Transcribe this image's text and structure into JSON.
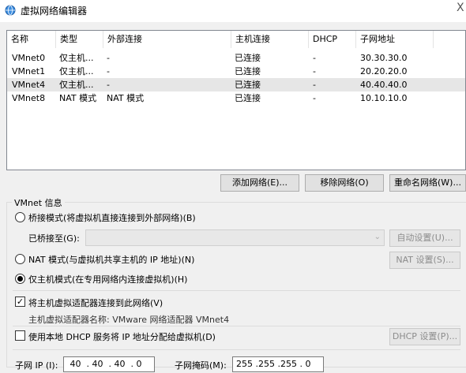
{
  "window": {
    "title": "虚拟网络编辑器",
    "icon": "network-globe-icon",
    "close": "X"
  },
  "table": {
    "headers": [
      "名称",
      "类型",
      "外部连接",
      "主机连接",
      "DHCP",
      "子网地址"
    ],
    "rows": [
      {
        "name": "VMnet0",
        "type": "仅主机...",
        "external": "-",
        "host": "已连接",
        "dhcp": "-",
        "subnet": "30.30.30.0",
        "selected": false
      },
      {
        "name": "VMnet1",
        "type": "仅主机...",
        "external": "-",
        "host": "已连接",
        "dhcp": "-",
        "subnet": "20.20.20.0",
        "selected": false
      },
      {
        "name": "VMnet4",
        "type": "仅主机...",
        "external": "-",
        "host": "已连接",
        "dhcp": "-",
        "subnet": "40.40.40.0",
        "selected": true
      },
      {
        "name": "VMnet8",
        "type": "NAT 模式",
        "external": "NAT 模式",
        "host": "已连接",
        "dhcp": "-",
        "subnet": "10.10.10.0",
        "selected": false
      }
    ]
  },
  "buttons": {
    "add": "添加网络(E)...",
    "remove": "移除网络(O)",
    "rename": "重命名网络(W)..."
  },
  "vmnet_info": {
    "title": "VMnet 信息",
    "bridged_label": "桥接模式(将虚拟机直接连接到外部网络)(B)",
    "bridged_to_label": "已桥接至(G):",
    "bridged_to_value": "",
    "auto_settings": "自动设置(U)...",
    "nat_label": "NAT 模式(与虚拟机共享主机的 IP 地址)(N)",
    "nat_settings": "NAT 设置(S)...",
    "hostonly_label": "仅主机模式(在专用网络内连接虚拟机)(H)",
    "mode_selected": "hostonly",
    "connect_adapter_label": "将主机虚拟适配器连接到此网络(V)",
    "connect_adapter_checked": true,
    "adapter_name_text": "主机虚拟适配器名称: VMware 网络适配器 VMnet4",
    "dhcp_label": "使用本地 DHCP 服务将 IP 地址分配给虚拟机(D)",
    "dhcp_checked": false,
    "dhcp_settings": "DHCP 设置(P)...",
    "subnet_ip_label": "子网 IP (I):",
    "subnet_ip_value": " 40  . 40  . 40  . 0",
    "subnet_mask_label": "子网掩码(M):",
    "subnet_mask_value": "255 .255 .255 . 0"
  }
}
